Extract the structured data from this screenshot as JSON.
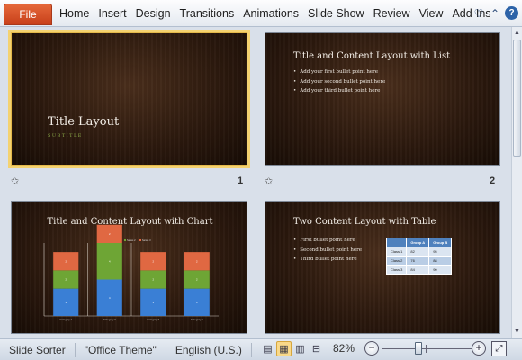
{
  "ribbon": {
    "file_label": "File",
    "tabs": [
      "Home",
      "Insert",
      "Design",
      "Transitions",
      "Animations",
      "Slide Show",
      "Review",
      "View",
      "Add-Ins"
    ],
    "right_icons": [
      "heart-icon",
      "minimize-ribbon-icon",
      "help-icon"
    ]
  },
  "slides": [
    {
      "number": "1",
      "selected": true,
      "layout": "title",
      "title": "Title Layout",
      "subtitle": "SUBTITLE"
    },
    {
      "number": "2",
      "selected": false,
      "layout": "title-and-list",
      "title": "Title and Content Layout with List",
      "bullets": [
        "Add your first bullet point here",
        "Add your second bullet point here",
        "Add your third bullet point here"
      ]
    },
    {
      "number": "",
      "selected": false,
      "layout": "title-and-chart",
      "title": "Title and Content Layout with Chart"
    },
    {
      "number": "",
      "selected": false,
      "layout": "two-content-table",
      "title": "Two Content Layout with Table",
      "bullets": [
        "First bullet point here",
        "Second bullet point here",
        "Third bullet point here"
      ],
      "table": {
        "headers": [
          "",
          "Group A",
          "Group B"
        ],
        "rows": [
          [
            "Class 1",
            "82",
            "95"
          ],
          [
            "Class 2",
            "76",
            "88"
          ],
          [
            "Class 3",
            "84",
            "90"
          ]
        ]
      }
    }
  ],
  "chart_data": {
    "type": "bar",
    "stacked": true,
    "categories": [
      "Category 1",
      "Category 2",
      "Category 3",
      "Category 4"
    ],
    "series": [
      {
        "name": "Series 1",
        "color": "#3a7fd5",
        "values": [
          3,
          4,
          3,
          3
        ]
      },
      {
        "name": "Series 2",
        "color": "#6ea535",
        "values": [
          2,
          4,
          2,
          2
        ]
      },
      {
        "name": "Series 3",
        "color": "#e06842",
        "values": [
          2,
          2,
          2,
          2
        ]
      }
    ],
    "legend": "top",
    "ylim": [
      0,
      8
    ]
  },
  "status": {
    "view": "Slide Sorter",
    "theme": "\"Office Theme\"",
    "language": "English (U.S.)",
    "zoom": "82%",
    "zoom_level": 0.41
  },
  "colors": {
    "file_tab": "#d4501f",
    "selected_outline": "#f4d270",
    "slide_background": "#2e1b0f",
    "subtitle_accent": "#8fb04a",
    "table_header": "#4f81bd"
  }
}
